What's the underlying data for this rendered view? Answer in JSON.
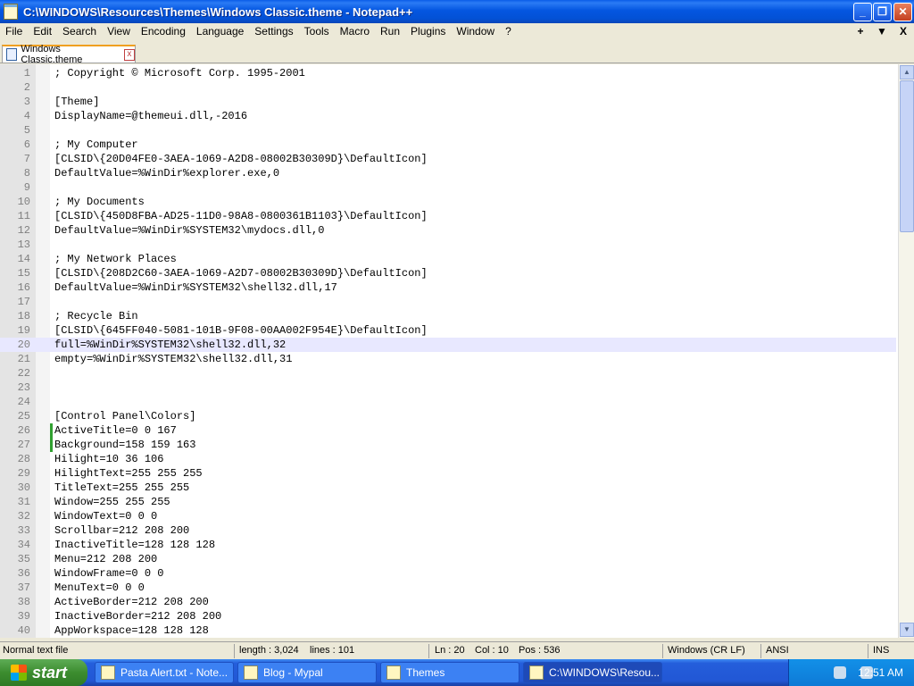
{
  "window": {
    "title": "C:\\WINDOWS\\Resources\\Themes\\Windows Classic.theme - Notepad++",
    "minimize": "_",
    "maximize": "❐",
    "close": "✕"
  },
  "menu": {
    "items": [
      "File",
      "Edit",
      "Search",
      "View",
      "Encoding",
      "Language",
      "Settings",
      "Tools",
      "Macro",
      "Run",
      "Plugins",
      "Window",
      "?"
    ],
    "right": [
      "+",
      "▼",
      "X"
    ]
  },
  "tab": {
    "label": "Windows Classic.theme",
    "close": "x"
  },
  "editor": {
    "current_line": 20,
    "changed_lines": [
      26,
      27
    ],
    "lines": [
      "; Copyright © Microsoft Corp. 1995-2001",
      "",
      "[Theme]",
      "DisplayName=@themeui.dll,-2016",
      "",
      "; My Computer",
      "[CLSID\\{20D04FE0-3AEA-1069-A2D8-08002B30309D}\\DefaultIcon]",
      "DefaultValue=%WinDir%explorer.exe,0",
      "",
      "; My Documents",
      "[CLSID\\{450D8FBA-AD25-11D0-98A8-0800361B1103}\\DefaultIcon]",
      "DefaultValue=%WinDir%SYSTEM32\\mydocs.dll,0",
      "",
      "; My Network Places",
      "[CLSID\\{208D2C60-3AEA-1069-A2D7-08002B30309D}\\DefaultIcon]",
      "DefaultValue=%WinDir%SYSTEM32\\shell32.dll,17",
      "",
      "; Recycle Bin",
      "[CLSID\\{645FF040-5081-101B-9F08-00AA002F954E}\\DefaultIcon]",
      "full=%WinDir%SYSTEM32\\shell32.dll,32",
      "empty=%WinDir%SYSTEM32\\shell32.dll,31",
      "",
      "",
      "",
      "[Control Panel\\Colors]",
      "ActiveTitle=0 0 167",
      "Background=158 159 163",
      "Hilight=10 36 106",
      "HilightText=255 255 255",
      "TitleText=255 255 255",
      "Window=255 255 255",
      "WindowText=0 0 0",
      "Scrollbar=212 208 200",
      "InactiveTitle=128 128 128",
      "Menu=212 208 200",
      "WindowFrame=0 0 0",
      "MenuText=0 0 0",
      "ActiveBorder=212 208 200",
      "InactiveBorder=212 208 200",
      "AppWorkspace=128 128 128"
    ]
  },
  "status": {
    "file_type": "Normal text file",
    "length": "length : 3,024",
    "lines": "lines : 101",
    "ln": "Ln : 20",
    "col": "Col : 10",
    "pos": "Pos : 536",
    "eol": "Windows (CR LF)",
    "encoding": "ANSI",
    "mode": "INS"
  },
  "taskbar": {
    "start": "start",
    "items": [
      {
        "label": "Pasta Alert.txt - Note...",
        "active": false
      },
      {
        "label": "Blog - Mypal",
        "active": false
      },
      {
        "label": "Themes",
        "active": false
      },
      {
        "label": "C:\\WINDOWS\\Resou...",
        "active": true
      }
    ],
    "clock": "12:51 AM"
  },
  "colors": {
    "titlebar": "#0456e0",
    "current_line_bg": "#e8e8ff",
    "change_marker": "#30a030",
    "tab_accent": "#f0a020"
  }
}
